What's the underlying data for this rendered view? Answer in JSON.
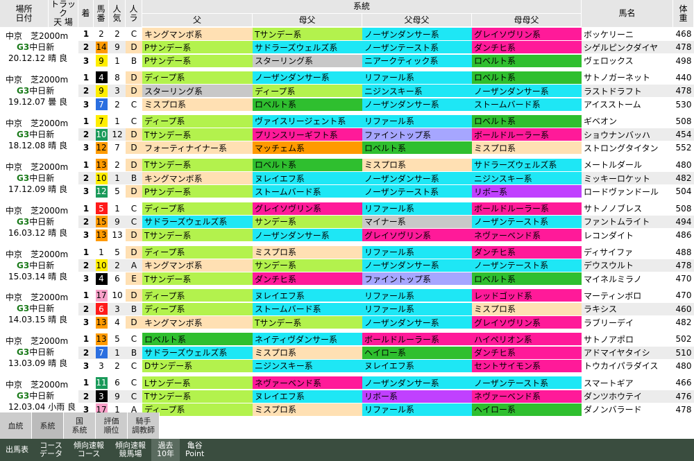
{
  "colors": {
    "header": "#e6e6e6",
    "row_alt": "#ececec",
    "row_plain": "#ffffff",
    "tan": "#ffe0b3",
    "green": "#b3f24d",
    "cyan": "#1ee7f5",
    "magenta": "#ff1a99",
    "gray": "#c8c8c8",
    "dgreen": "#2fbf2f",
    "orange": "#ff9a00",
    "lavender": "#a6a6ff",
    "violet": "#c040ff",
    "red": "#ff2a2a",
    "peach": "#ffddb0"
  },
  "header": {
    "place_date": [
      "場所",
      "日付"
    ],
    "track": [
      "トラック",
      "天 場"
    ],
    "finish": "着",
    "number": [
      "馬",
      "番"
    ],
    "pop": [
      "人",
      "気"
    ],
    "la": [
      "人",
      "ラ"
    ],
    "lineage": "系統",
    "sire": "父",
    "dam_sire": "母父",
    "sire_dam_sire": "父母父",
    "dam_dam_sire": "母母父",
    "horse_name": "馬名",
    "weight": [
      "体",
      "重"
    ]
  },
  "races": [
    {
      "course": "中京　芝2000m",
      "race": "G3",
      "race_name": "中日新",
      "date_cond": "20.12.12 晴 良",
      "rows": [
        {
          "f": "1",
          "n": "2",
          "nc": "",
          "p": "2",
          "r": "C",
          "rc": "",
          "s": "キングマンボ系",
          "sc": "tan",
          "d": "Tサンデー系",
          "dc": "green",
          "sd": "ノーザンダンサー系",
          "sdc": "cyan",
          "dd": "グレイソヴリン系",
          "ddc": "magenta",
          "name": "ボッケリーニ",
          "w": "468"
        },
        {
          "f": "2",
          "n": "14",
          "nc": "orange",
          "p": "9",
          "r": "D",
          "rc": "tan",
          "s": "Pサンデー系",
          "sc": "green",
          "d": "サドラーズウェルズ系",
          "dc": "cyan",
          "sd": "ノーザンテースト系",
          "sdc": "cyan",
          "dd": "ダンチヒ系",
          "ddc": "magenta",
          "name": "シゲルピンクダイヤ",
          "w": "478"
        },
        {
          "f": "3",
          "n": "9",
          "nc": "yellow",
          "p": "1",
          "r": "B",
          "rc": "",
          "s": "Pサンデー系",
          "sc": "green",
          "d": "スターリング系",
          "dc": "gray",
          "sd": "ニアークティック系",
          "sdc": "cyan",
          "dd": "ロベルト系",
          "ddc": "dgreen",
          "name": "ヴェロックス",
          "w": "498"
        }
      ]
    },
    {
      "course": "中京　芝2000m",
      "race": "G3",
      "race_name": "中日新",
      "date_cond": "19.12.07 曇 良",
      "rows": [
        {
          "f": "1",
          "n": "4",
          "nc": "black",
          "p": "8",
          "r": "D",
          "rc": "tan",
          "s": "ディープ系",
          "sc": "green",
          "d": "ノーザンダンサー系",
          "dc": "cyan",
          "sd": "リファール系",
          "sdc": "cyan",
          "dd": "ロベルト系",
          "ddc": "dgreen",
          "name": "サトノガーネット",
          "w": "440"
        },
        {
          "f": "2",
          "n": "9",
          "nc": "yellow",
          "p": "3",
          "r": "D",
          "rc": "tan",
          "s": "スターリング系",
          "sc": "gray",
          "d": "ディープ系",
          "dc": "green",
          "sd": "ニジンスキー系",
          "sdc": "cyan",
          "dd": "ノーザンダンサー系",
          "ddc": "cyan",
          "name": "ラストドラフト",
          "w": "478"
        },
        {
          "f": "3",
          "n": "7",
          "nc": "blue",
          "p": "2",
          "r": "C",
          "rc": "",
          "s": "ミスプロ系",
          "sc": "tan",
          "d": "ロベルト系",
          "dc": "dgreen",
          "sd": "ノーザンダンサー系",
          "sdc": "cyan",
          "dd": "ストームバード系",
          "ddc": "cyan",
          "name": "アイスストーム",
          "w": "530"
        }
      ]
    },
    {
      "course": "中京　芝2000m",
      "race": "G3",
      "race_name": "中日新",
      "date_cond": "18.12.08 晴 良",
      "rows": [
        {
          "f": "1",
          "n": "7",
          "nc": "yellow",
          "p": "1",
          "r": "C",
          "rc": "",
          "s": "ディープ系",
          "sc": "green",
          "d": "ヴァイスリージェント系",
          "dc": "cyan",
          "sd": "リファール系",
          "sdc": "cyan",
          "dd": "ロベルト系",
          "ddc": "dgreen",
          "name": "ギベオン",
          "w": "508"
        },
        {
          "f": "2",
          "n": "10",
          "nc": "teal",
          "p": "12",
          "r": "D",
          "rc": "tan",
          "s": "Tサンデー系",
          "sc": "green",
          "d": "プリンスリーギフト系",
          "dc": "magenta",
          "sd": "ファイントップ系",
          "sdc": "lavender",
          "dd": "ボールドルーラー系",
          "ddc": "magenta",
          "name": "ショウナンバッハ",
          "w": "454"
        },
        {
          "f": "3",
          "n": "12",
          "nc": "orange",
          "p": "7",
          "r": "D",
          "rc": "tan",
          "s": "フォーティナイナー系",
          "sc": "tan",
          "d": "マッチェム系",
          "dc": "orange",
          "sd": "ロベルト系",
          "sdc": "dgreen",
          "dd": "ミスプロ系",
          "ddc": "tan",
          "name": "ストロングタイタン",
          "w": "552"
        }
      ]
    },
    {
      "course": "中京　芝2000m",
      "race": "G3",
      "race_name": "中日新",
      "date_cond": "17.12.09 晴 良",
      "rows": [
        {
          "f": "1",
          "n": "13",
          "nc": "orange",
          "p": "2",
          "r": "D",
          "rc": "tan",
          "s": "Tサンデー系",
          "sc": "green",
          "d": "ロベルト系",
          "dc": "dgreen",
          "sd": "ミスプロ系",
          "sdc": "tan",
          "dd": "サドラーズウェルズ系",
          "ddc": "cyan",
          "name": "メートルダール",
          "w": "480"
        },
        {
          "f": "2",
          "n": "10",
          "nc": "yellow",
          "p": "1",
          "r": "B",
          "rc": "",
          "s": "キングマンボ系",
          "sc": "tan",
          "d": "ヌレイエフ系",
          "dc": "cyan",
          "sd": "ノーザンダンサー系",
          "sdc": "cyan",
          "dd": "ニジンスキー系",
          "ddc": "cyan",
          "name": "ミッキーロケット",
          "w": "482"
        },
        {
          "f": "3",
          "n": "12",
          "nc": "teal",
          "p": "5",
          "r": "D",
          "rc": "tan",
          "s": "Pサンデー系",
          "sc": "green",
          "d": "ストームバード系",
          "dc": "cyan",
          "sd": "ノーザンテースト系",
          "sdc": "cyan",
          "dd": "リボー系",
          "ddc": "violet",
          "name": "ロードヴァンドール",
          "w": "504"
        }
      ]
    },
    {
      "course": "中京　芝2000m",
      "race": "G3",
      "race_name": "中日新",
      "date_cond": "16.03.12 晴 良",
      "rows": [
        {
          "f": "1",
          "n": "5",
          "nc": "red",
          "p": "1",
          "r": "C",
          "rc": "",
          "s": "ディープ系",
          "sc": "green",
          "d": "グレイソヴリン系",
          "dc": "magenta",
          "sd": "リファール系",
          "sdc": "cyan",
          "dd": "ボールドルーラー系",
          "ddc": "magenta",
          "name": "サトノノブレス",
          "w": "508"
        },
        {
          "f": "2",
          "n": "15",
          "nc": "orange",
          "p": "9",
          "r": "C",
          "rc": "",
          "s": "サドラーズウェルズ系",
          "sc": "cyan",
          "d": "サンデー系",
          "dc": "green",
          "sd": "マイナー系",
          "sdc": "gray",
          "dd": "ノーザンテースト系",
          "ddc": "cyan",
          "name": "ファントムライト",
          "w": "494"
        },
        {
          "f": "3",
          "n": "13",
          "nc": "orange",
          "p": "13",
          "r": "D",
          "rc": "tan",
          "s": "Tサンデー系",
          "sc": "green",
          "d": "ノーザンダンサー系",
          "dc": "cyan",
          "sd": "グレイソヴリン系",
          "sdc": "magenta",
          "dd": "ネヴァーベンド系",
          "ddc": "magenta",
          "name": "レコンダイト",
          "w": "486"
        }
      ]
    },
    {
      "course": "中京　芝2000m",
      "race": "G3",
      "race_name": "中日新",
      "date_cond": "15.03.14 晴 良",
      "rows": [
        {
          "f": "1",
          "n": "1",
          "nc": "",
          "p": "5",
          "r": "D",
          "rc": "tan",
          "s": "ディープ系",
          "sc": "green",
          "d": "ミスプロ系",
          "dc": "tan",
          "sd": "リファール系",
          "sdc": "cyan",
          "dd": "ダンチヒ系",
          "ddc": "magenta",
          "name": "ディサイファ",
          "w": "488"
        },
        {
          "f": "2",
          "n": "10",
          "nc": "yellow",
          "p": "2",
          "r": "A",
          "rc": "",
          "s": "キングマンボ系",
          "sc": "tan",
          "d": "サンデー系",
          "dc": "green",
          "sd": "ノーザンダンサー系",
          "sdc": "cyan",
          "dd": "ノーザンテースト系",
          "ddc": "cyan",
          "name": "デウスウルト",
          "w": "478"
        },
        {
          "f": "3",
          "n": "4",
          "nc": "black",
          "p": "6",
          "r": "E",
          "rc": "tan",
          "s": "Tサンデー系",
          "sc": "green",
          "d": "ダンチヒ系",
          "dc": "magenta",
          "sd": "ファイントップ系",
          "sdc": "lavender",
          "dd": "ロベルト系",
          "ddc": "dgreen",
          "name": "マイネルミラノ",
          "w": "470"
        }
      ]
    },
    {
      "course": "中京　芝2000m",
      "race": "G3",
      "race_name": "中日新",
      "date_cond": "14.03.15 晴 良",
      "rows": [
        {
          "f": "1",
          "n": "17",
          "nc": "pink",
          "p": "10",
          "r": "D",
          "rc": "tan",
          "s": "ディープ系",
          "sc": "green",
          "d": "ヌレイエフ系",
          "dc": "cyan",
          "sd": "リファール系",
          "sdc": "cyan",
          "dd": "レッドゴッド系",
          "ddc": "magenta",
          "name": "マーティンボロ",
          "w": "470"
        },
        {
          "f": "2",
          "n": "6",
          "nc": "red",
          "p": "3",
          "r": "B",
          "rc": "",
          "s": "ディープ系",
          "sc": "green",
          "d": "ストームバード系",
          "dc": "cyan",
          "sd": "リファール系",
          "sdc": "cyan",
          "dd": "ミスプロ系",
          "ddc": "tan",
          "name": "ラキシス",
          "w": "460"
        },
        {
          "f": "3",
          "n": "13",
          "nc": "orange",
          "p": "4",
          "r": "D",
          "rc": "tan",
          "s": "キングマンボ系",
          "sc": "tan",
          "d": "Tサンデー系",
          "dc": "green",
          "sd": "ノーザンダンサー系",
          "sdc": "cyan",
          "dd": "グレイソヴリン系",
          "ddc": "magenta",
          "name": "ラブリーデイ",
          "w": "482"
        }
      ]
    },
    {
      "course": "中京　芝2000m",
      "race": "G3",
      "race_name": "中日新",
      "date_cond": "13.03.09 晴 良",
      "rows": [
        {
          "f": "1",
          "n": "13",
          "nc": "orange",
          "p": "5",
          "r": "C",
          "rc": "",
          "s": "ロベルト系",
          "sc": "dgreen",
          "d": "ネイティヴダンサー系",
          "dc": "cyan",
          "sd": "ボールドルーラー系",
          "sdc": "magenta",
          "dd": "ハイペリオン系",
          "ddc": "magenta",
          "name": "サトノアポロ",
          "w": "502"
        },
        {
          "f": "2",
          "n": "7",
          "nc": "blue",
          "p": "1",
          "r": "B",
          "rc": "",
          "s": "サドラーズウェルズ系",
          "sc": "cyan",
          "d": "ミスプロ系",
          "dc": "tan",
          "sd": "ヘイロー系",
          "sdc": "dgreen",
          "dd": "ダンチヒ系",
          "ddc": "magenta",
          "name": "アドマイヤタイシ",
          "w": "510"
        },
        {
          "f": "3",
          "n": "3",
          "nc": "",
          "p": "2",
          "r": "C",
          "rc": "",
          "s": "Dサンデー系",
          "sc": "green",
          "d": "ニジンスキー系",
          "dc": "cyan",
          "sd": "ヌレイエフ系",
          "sdc": "cyan",
          "dd": "セントサイモン系",
          "ddc": "magenta",
          "name": "トウカイパラダイス",
          "w": "480"
        }
      ]
    },
    {
      "course": "中京　芝2000m",
      "race": "G3",
      "race_name": "中日新",
      "date_cond": "12.03.04 小雨 良",
      "rows": [
        {
          "f": "1",
          "n": "11",
          "nc": "teal",
          "p": "6",
          "r": "C",
          "rc": "",
          "s": "Lサンデー系",
          "sc": "green",
          "d": "ネヴァーベンド系",
          "dc": "magenta",
          "sd": "ノーザンダンサー系",
          "sdc": "cyan",
          "dd": "ノーザンテースト系",
          "ddc": "cyan",
          "name": "スマートギア",
          "w": "466"
        },
        {
          "f": "2",
          "n": "3",
          "nc": "black",
          "p": "9",
          "r": "C",
          "rc": "",
          "s": "Tサンデー系",
          "sc": "green",
          "d": "ヌレイエフ系",
          "dc": "cyan",
          "sd": "リボー系",
          "sdc": "violet",
          "dd": "ネヴァーベンド系",
          "ddc": "magenta",
          "name": "ダンツホウテイ",
          "w": "476"
        },
        {
          "f": "3",
          "n": "17",
          "nc": "pink",
          "p": "1",
          "r": "A",
          "rc": "",
          "s": "ディープ系",
          "sc": "green",
          "d": "ミスプロ系",
          "dc": "tan",
          "sd": "リファール系",
          "sdc": "cyan",
          "dd": "ヘイロー系",
          "ddc": "dgreen",
          "name": "ダノンバラード",
          "w": "478"
        }
      ]
    }
  ],
  "tabs": [
    {
      "label": "血統",
      "on": false
    },
    {
      "label": "系統",
      "on": true
    },
    {
      "label": "国\n系統",
      "on": false
    },
    {
      "label": "評価\n順位",
      "on": false
    },
    {
      "label": "騎手\n調教師",
      "on": false
    }
  ],
  "bottom": [
    {
      "label": "出馬表",
      "on": false
    },
    {
      "label": "コース\nデータ",
      "on": false
    },
    {
      "label": "傾向速報\nコース",
      "on": false
    },
    {
      "label": "傾向速報\n競馬場",
      "on": false
    },
    {
      "label": "過去\n10年",
      "on": true
    },
    {
      "label": "亀谷\nPoint",
      "on": false
    }
  ]
}
